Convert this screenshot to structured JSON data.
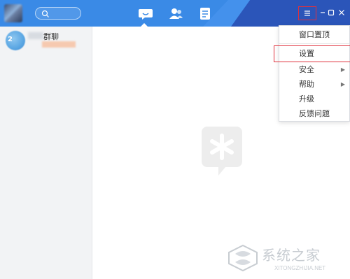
{
  "header": {
    "nav": [
      "chat-bubble-icon",
      "contacts-icon",
      "document-icon"
    ],
    "window_controls": [
      "menu-icon",
      "minimize-icon",
      "maximize-icon",
      "close-icon"
    ],
    "colors": {
      "primary": "#3a8ae6",
      "dark": "#2b55b9",
      "highlight": "#e0303c"
    }
  },
  "sidebar": {
    "chats": [
      {
        "title": "群聊",
        "avatar_badge": "2"
      }
    ]
  },
  "menu": {
    "items": [
      {
        "label": "窗口置顶",
        "has_submenu": false
      },
      {
        "label": "设置",
        "has_submenu": false,
        "highlighted": true
      },
      {
        "label": "安全",
        "has_submenu": true
      },
      {
        "label": "帮助",
        "has_submenu": true
      },
      {
        "label": "升级",
        "has_submenu": false
      },
      {
        "label": "反馈问题",
        "has_submenu": false
      }
    ]
  },
  "watermark": {
    "text": "系统之家",
    "url": "XITONGZHIJIA.NET"
  }
}
